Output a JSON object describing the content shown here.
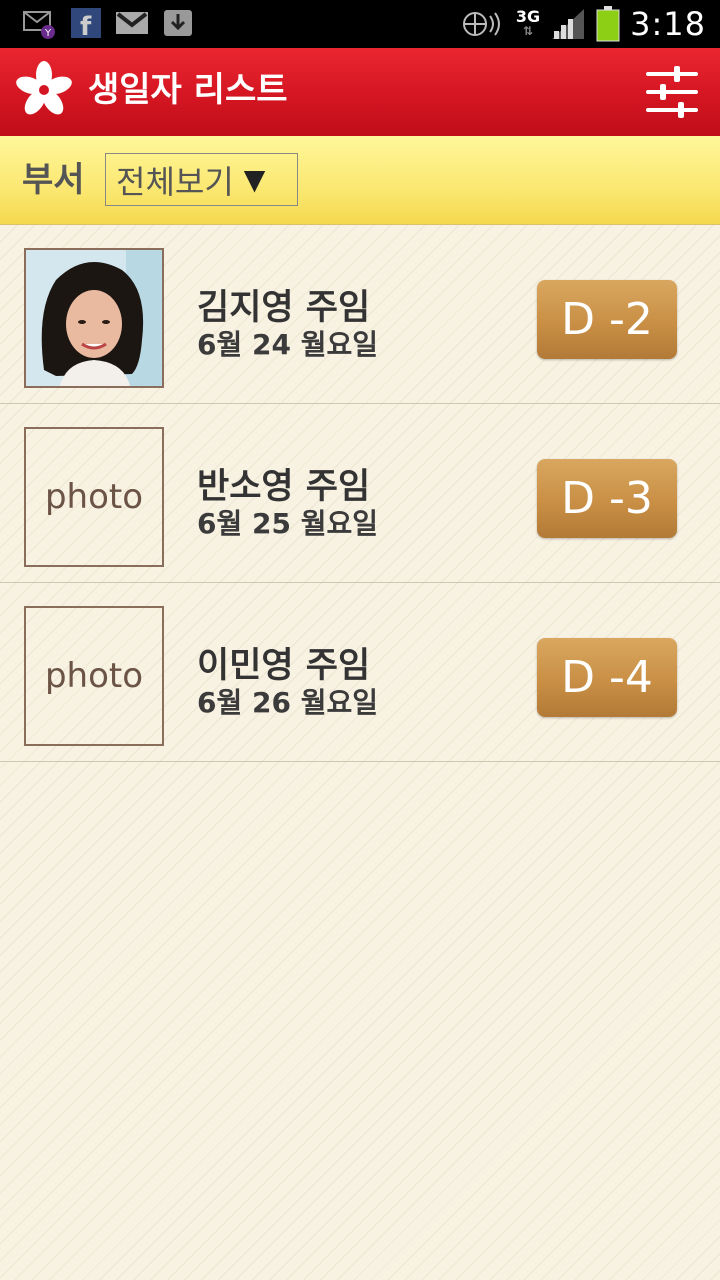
{
  "status_bar": {
    "time": "3:18",
    "network": "3G",
    "left_icons": [
      "yahoo-mail-icon",
      "facebook-icon",
      "gmail-icon",
      "download-icon"
    ],
    "right_icons": [
      "sync-icon",
      "signal-icon",
      "battery-icon"
    ]
  },
  "header": {
    "title": "생일자 리스트",
    "logo_icon": "flower-logo-icon",
    "settings_icon": "sliders-icon",
    "color": "#d41622"
  },
  "filter": {
    "label": "부서",
    "selected": "전체보기",
    "arrow": "▼"
  },
  "people": [
    {
      "name": "김지영 주임",
      "date": "6월 24 월요일",
      "dday": "D -2",
      "photo": ""
    },
    {
      "name": "반소영 주임",
      "date": "6월 25 월요일",
      "dday": "D -3",
      "photo": "photo"
    },
    {
      "name": "이민영 주임",
      "date": "6월 26 월요일",
      "dday": "D -4",
      "photo": "photo"
    }
  ]
}
